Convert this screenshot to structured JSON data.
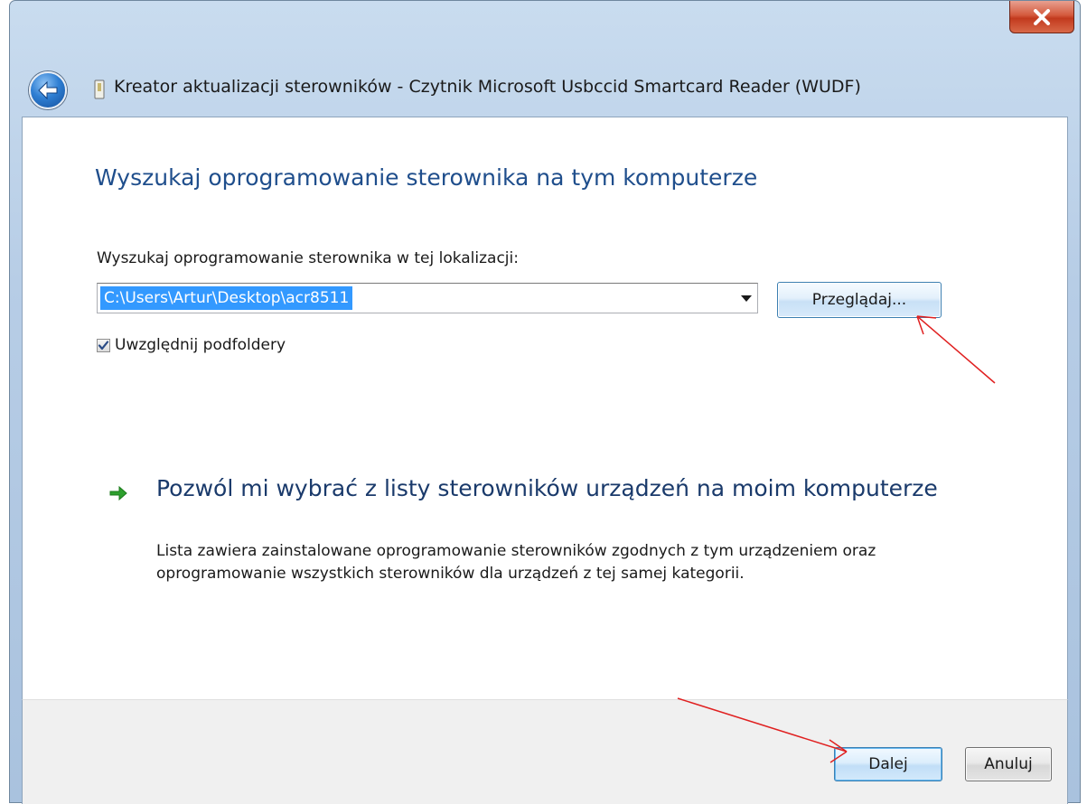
{
  "window": {
    "title": "Kreator aktualizacji sterowników - Czytnik Microsoft Usbccid Smartcard Reader (WUDF)"
  },
  "icons": {
    "close": "close-x-icon",
    "back": "back-arrow-icon",
    "device": "smartcard-reader-icon",
    "option_arrow": "green-arrow-icon",
    "dropdown": "chevron-down-icon"
  },
  "main": {
    "heading": "Wyszukaj oprogramowanie sterownika na tym komputerze",
    "path_label": "Wyszukaj oprogramowanie sterownika w tej lokalizacji:",
    "path_value": "C:\\Users\\Artur\\Desktop\\acr8511",
    "browse_label": "Przeglądaj...",
    "include_subfolders_label": "Uwzględnij podfoldery",
    "include_subfolders_checked": true,
    "option": {
      "title": "Pozwól mi wybrać z listy sterowników urządzeń na moim komputerze",
      "description": "Lista zawiera zainstalowane oprogramowanie sterowników zgodnych z tym urządzeniem oraz oprogramowanie wszystkich sterowników dla urządzeń z tej samej kategorii."
    }
  },
  "footer": {
    "next_label": "Dalej",
    "cancel_label": "Anuluj"
  },
  "colors": {
    "heading": "#1f4e8c",
    "selection": "#3399ff",
    "annotation_arrow": "#e02020",
    "option_arrow": "#2ea02e"
  }
}
